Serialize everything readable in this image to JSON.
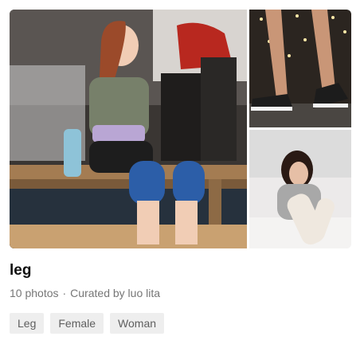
{
  "collection": {
    "title": "leg",
    "photo_count_text": "10 photos",
    "separator": "·",
    "curated_by_text": "Curated by luo lita",
    "tags": [
      "Leg",
      "Female",
      "Woman"
    ]
  },
  "photos": [
    {
      "name": "woman in gym with knee sleeves"
    },
    {
      "name": "legs in black sneakers with lights"
    },
    {
      "name": "woman on bed with leg warmers"
    }
  ],
  "colors": {
    "title": "#111111",
    "meta": "#767676",
    "tag_bg": "#eeeeee",
    "tag_text": "#5f5f5f"
  }
}
